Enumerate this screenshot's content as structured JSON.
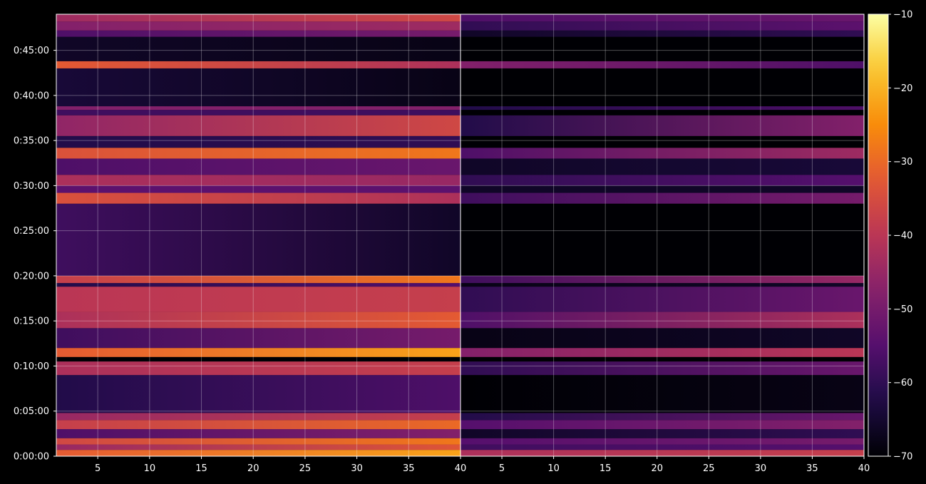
{
  "chart_data": {
    "type": "heatmap",
    "title": "",
    "xlabel": "",
    "ylabel": "",
    "panels": [
      {
        "name": "",
        "xlim": [
          1,
          40
        ],
        "xticks": [
          5,
          10,
          15,
          20,
          25,
          30,
          35,
          40
        ]
      },
      {
        "name": "",
        "xlim": [
          1,
          40
        ],
        "xticks": [
          5,
          10,
          15,
          20,
          25,
          30,
          35,
          40
        ]
      }
    ],
    "y": {
      "unit": "minutes",
      "ylim": [
        0,
        49
      ],
      "ticks": [
        {
          "value": 0,
          "label": "0:00:00"
        },
        {
          "value": 5,
          "label": "0:05:00"
        },
        {
          "value": 10,
          "label": "0:10:00"
        },
        {
          "value": 15,
          "label": "0:15:00"
        },
        {
          "value": 20,
          "label": "0:20:00"
        },
        {
          "value": 25,
          "label": "0:25:00"
        },
        {
          "value": 30,
          "label": "0:30:00"
        },
        {
          "value": 35,
          "label": "0:35:00"
        },
        {
          "value": 40,
          "label": "0:40:00"
        },
        {
          "value": 45,
          "label": "0:45:00"
        }
      ]
    },
    "colorbar": {
      "colormap": "inferno",
      "range": [
        -70,
        -10
      ],
      "ticks": [
        -70,
        -60,
        -50,
        -40,
        -30,
        -20,
        -10
      ],
      "tick_labels": [
        "−70",
        "−60",
        "−50",
        "−40",
        "−30",
        "−20",
        "−10"
      ]
    },
    "grid": true,
    "bands": [
      {
        "y0": 0.0,
        "y1": 0.7,
        "left": [
          -32,
          -22
        ],
        "right": [
          -42,
          -38
        ]
      },
      {
        "y0": 0.7,
        "y1": 1.3,
        "left": [
          -45,
          -33
        ],
        "right": [
          -58,
          -55
        ]
      },
      {
        "y0": 1.3,
        "y1": 2.0,
        "left": [
          -36,
          -28
        ],
        "right": [
          -55,
          -50
        ]
      },
      {
        "y0": 2.0,
        "y1": 3.0,
        "left": [
          -56,
          -48
        ],
        "right": [
          -66,
          -60
        ]
      },
      {
        "y0": 3.0,
        "y1": 4.0,
        "left": [
          -38,
          -30
        ],
        "right": [
          -55,
          -48
        ]
      },
      {
        "y0": 4.0,
        "y1": 4.8,
        "left": [
          -45,
          -38
        ],
        "right": [
          -62,
          -52
        ]
      },
      {
        "y0": 4.8,
        "y1": 9.0,
        "left": [
          -62,
          -56
        ],
        "right": [
          -70,
          -68
        ]
      },
      {
        "y0": 9.0,
        "y1": 10.5,
        "left": [
          -42,
          -38
        ],
        "right": [
          -60,
          -52
        ]
      },
      {
        "y0": 11.0,
        "y1": 12.0,
        "left": [
          -32,
          -22
        ],
        "right": [
          -48,
          -40
        ]
      },
      {
        "y0": 12.0,
        "y1": 14.2,
        "left": [
          -58,
          -50
        ],
        "right": [
          -68,
          -66
        ]
      },
      {
        "y0": 14.2,
        "y1": 16.0,
        "left": [
          -42,
          -32
        ],
        "right": [
          -56,
          -42
        ]
      },
      {
        "y0": 16.0,
        "y1": 18.8,
        "left": [
          -40,
          -38
        ],
        "right": [
          -60,
          -52
        ]
      },
      {
        "y0": 18.8,
        "y1": 19.2,
        "left": [
          -62,
          -55
        ],
        "right": [
          -68,
          -66
        ]
      },
      {
        "y0": 19.2,
        "y1": 20.0,
        "left": [
          -38,
          -28
        ],
        "right": [
          -58,
          -45
        ]
      },
      {
        "y0": 20.0,
        "y1": 28.0,
        "left": [
          -58,
          -66
        ],
        "right": [
          -70,
          -70
        ]
      },
      {
        "y0": 28.0,
        "y1": 29.2,
        "left": [
          -34,
          -42
        ],
        "right": [
          -58,
          -50
        ]
      },
      {
        "y0": 29.2,
        "y1": 30.0,
        "left": [
          -54,
          -54
        ],
        "right": [
          -66,
          -66
        ]
      },
      {
        "y0": 30.0,
        "y1": 31.2,
        "left": [
          -42,
          -45
        ],
        "right": [
          -60,
          -55
        ]
      },
      {
        "y0": 31.2,
        "y1": 33.0,
        "left": [
          -56,
          -52
        ],
        "right": [
          -66,
          -64
        ]
      },
      {
        "y0": 33.0,
        "y1": 34.2,
        "left": [
          -34,
          -28
        ],
        "right": [
          -56,
          -44
        ]
      },
      {
        "y0": 34.2,
        "y1": 35.5,
        "left": [
          -62,
          -60
        ],
        "right": [
          -70,
          -70
        ]
      },
      {
        "y0": 35.5,
        "y1": 37.8,
        "left": [
          -46,
          -36
        ],
        "right": [
          -62,
          -48
        ]
      },
      {
        "y0": 37.8,
        "y1": 38.4,
        "left": [
          -58,
          -58
        ],
        "right": [
          -70,
          -70
        ]
      },
      {
        "y0": 38.4,
        "y1": 38.8,
        "left": [
          -48,
          -48
        ],
        "right": [
          -62,
          -56
        ]
      },
      {
        "y0": 38.8,
        "y1": 43.0,
        "left": [
          -64,
          -68
        ],
        "right": [
          -70,
          -70
        ]
      },
      {
        "y0": 43.0,
        "y1": 43.8,
        "left": [
          -32,
          -42
        ],
        "right": [
          -48,
          -56
        ]
      },
      {
        "y0": 43.8,
        "y1": 46.5,
        "left": [
          -66,
          -68
        ],
        "right": [
          -70,
          -70
        ]
      },
      {
        "y0": 46.5,
        "y1": 47.2,
        "left": [
          -56,
          -50
        ],
        "right": [
          -66,
          -60
        ]
      },
      {
        "y0": 47.2,
        "y1": 48.2,
        "left": [
          -48,
          -44
        ],
        "right": [
          -60,
          -54
        ]
      },
      {
        "y0": 48.2,
        "y1": 49.0,
        "left": [
          -44,
          -36
        ],
        "right": [
          -56,
          -52
        ]
      }
    ]
  }
}
